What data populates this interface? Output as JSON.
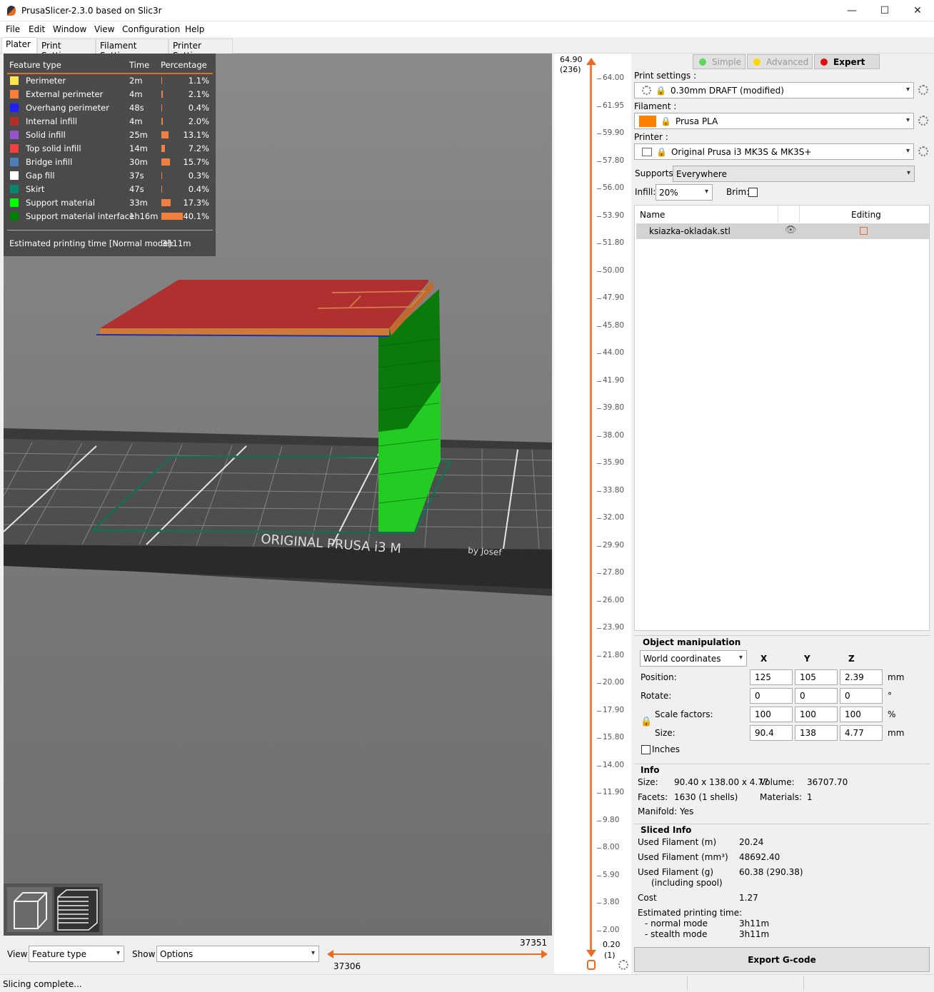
{
  "window": {
    "title": "PrusaSlicer-2.3.0 based on Slic3r",
    "controls": {
      "minimize": "—",
      "maximize": "☐",
      "close": "✕"
    }
  },
  "menu": [
    "File",
    "Edit",
    "Window",
    "View",
    "Configuration",
    "Help"
  ],
  "tabs": [
    "Plater",
    "Print Settings",
    "Filament Settings",
    "Printer Settings"
  ],
  "legend": {
    "headers": {
      "feature": "Feature type",
      "time": "Time",
      "percentage": "Percentage"
    },
    "rows": [
      {
        "name": "Perimeter",
        "time": "2m",
        "pct": "1.1%",
        "color": "#ffe64d",
        "fraction": 0.011
      },
      {
        "name": "External perimeter",
        "time": "4m",
        "pct": "2.1%",
        "color": "#ff7d38",
        "fraction": 0.021
      },
      {
        "name": "Overhang perimeter",
        "time": "48s",
        "pct": "0.4%",
        "color": "#1f1fff",
        "fraction": 0.004
      },
      {
        "name": "Internal infill",
        "time": "4m",
        "pct": "2.0%",
        "color": "#b03029",
        "fraction": 0.02
      },
      {
        "name": "Solid infill",
        "time": "25m",
        "pct": "13.1%",
        "color": "#9654cc",
        "fraction": 0.131
      },
      {
        "name": "Top solid infill",
        "time": "14m",
        "pct": "7.2%",
        "color": "#f04040",
        "fraction": 0.072
      },
      {
        "name": "Bridge infill",
        "time": "30m",
        "pct": "15.7%",
        "color": "#4d80ba",
        "fraction": 0.157
      },
      {
        "name": "Gap fill",
        "time": "37s",
        "pct": "0.3%",
        "color": "#ffffff",
        "fraction": 0.003
      },
      {
        "name": "Skirt",
        "time": "47s",
        "pct": "0.4%",
        "color": "#00876e",
        "fraction": 0.004
      },
      {
        "name": "Support material",
        "time": "33m",
        "pct": "17.3%",
        "color": "#00ff00",
        "fraction": 0.173
      },
      {
        "name": "Support material interface",
        "time": "1h16m",
        "pct": "40.1%",
        "color": "#008000",
        "fraction": 0.401
      }
    ],
    "estimated_label": "Estimated printing time [Normal mode]:",
    "estimated_value": "3h11m"
  },
  "bed_text": "ORIGINAL PRUSA i3 M",
  "bed_subtext": "by Josef",
  "vertical_slider": {
    "top_value": "64.90",
    "top_layer": "(236)",
    "bottom_value": "0.20",
    "bottom_layer": "(1)",
    "ticks": [
      "64.00",
      "61.95",
      "59.90",
      "57.80",
      "56.00",
      "53.90",
      "51.80",
      "50.00",
      "47.90",
      "45.80",
      "44.00",
      "41.90",
      "39.80",
      "38.00",
      "35.90",
      "33.80",
      "32.00",
      "29.90",
      "27.80",
      "26.00",
      "23.90",
      "21.80",
      "20.00",
      "17.90",
      "15.80",
      "14.00",
      "11.90",
      "9.80",
      "8.00",
      "5.90",
      "3.80",
      "2.00"
    ]
  },
  "modes": {
    "simple": "Simple",
    "advanced": "Advanced",
    "expert": "Expert"
  },
  "presets": {
    "print_label": "Print settings :",
    "print_value": "0.30mm DRAFT (modified)",
    "filament_label": "Filament :",
    "filament_value": "Prusa PLA",
    "filament_color": "#ff8000",
    "printer_label": "Printer :",
    "printer_value": "Original Prusa i3 MK3S & MK3S+",
    "supports_label": "Supports:",
    "supports_value": "Everywhere",
    "infill_label": "Infill:",
    "infill_value": "20%",
    "brim_label": "Brim:"
  },
  "object_list": {
    "col_name": "Name",
    "col_editing": "Editing",
    "items": [
      {
        "name": "ksiazka-okladak.stl"
      }
    ]
  },
  "manipulation": {
    "title": "Object manipulation",
    "coords": "World coordinates",
    "axes": [
      "X",
      "Y",
      "Z"
    ],
    "position_label": "Position:",
    "position": [
      "125",
      "105",
      "2.39"
    ],
    "position_unit": "mm",
    "rotate_label": "Rotate:",
    "rotate": [
      "0",
      "0",
      "0"
    ],
    "rotate_unit": "°",
    "scale_label": "Scale factors:",
    "scale": [
      "100",
      "100",
      "100"
    ],
    "scale_unit": "%",
    "size_label": "Size:",
    "size": [
      "90.4",
      "138",
      "4.77"
    ],
    "size_unit": "mm",
    "inches_label": "Inches"
  },
  "info": {
    "title": "Info",
    "size_label": "Size:",
    "size_value": "90.40 x 138.00 x 4.77",
    "volume_label": "Volume:",
    "volume_value": "36707.70",
    "facets_label": "Facets:",
    "facets_value": "1630 (1 shells)",
    "materials_label": "Materials:",
    "materials_value": "1",
    "manifold": "Manifold: Yes"
  },
  "sliced": {
    "title": "Sliced Info",
    "used_m_label": "Used Filament (m)",
    "used_m": "20.24",
    "used_mm3_label": "Used Filament (mm³)",
    "used_mm3": "48692.40",
    "used_g_label": "Used Filament (g)",
    "used_g_sub": "(including spool)",
    "used_g": "60.38 (290.38)",
    "cost_label": "Cost",
    "cost": "1.27",
    "est_label": "Estimated printing time:",
    "normal_label": "- normal mode",
    "normal": "3h11m",
    "stealth_label": "- stealth mode",
    "stealth": "3h11m"
  },
  "export_label": "Export G-code",
  "bottom": {
    "view_label": "View",
    "view_value": "Feature type",
    "show_label": "Show",
    "show_value": "Options",
    "hslider_low": "37306",
    "hslider_high": "37351"
  },
  "status": "Slicing complete..."
}
